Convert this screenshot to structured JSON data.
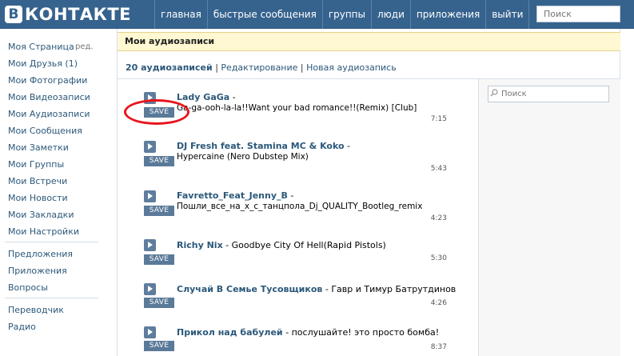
{
  "header": {
    "logo_letter": "В",
    "logo_text": "КОНТАКТЕ",
    "nav": [
      "главная",
      "быстрые сообщения",
      "группы",
      "люди",
      "приложения",
      "выйти"
    ],
    "search_placeholder": "Поиск"
  },
  "sidebar": {
    "items": [
      {
        "label": "Моя Страница",
        "edit": "ред."
      },
      {
        "label": "Мои Друзья (1)"
      },
      {
        "label": "Мои Фотографии"
      },
      {
        "label": "Мои Видеозаписи"
      },
      {
        "label": "Мои Аудиозаписи"
      },
      {
        "label": "Мои Сообщения"
      },
      {
        "label": "Мои Заметки"
      },
      {
        "label": "Мои Группы"
      },
      {
        "label": "Мои Встречи"
      },
      {
        "label": "Мои Новости"
      },
      {
        "label": "Мои Закладки"
      },
      {
        "label": "Мои Настройки"
      }
    ],
    "extra1": [
      "Предложения",
      "Приложения",
      "Вопросы"
    ],
    "extra2": [
      "Переводчик",
      "Радио"
    ]
  },
  "main": {
    "title": "Мои аудиозаписи",
    "count": "20 аудиозаписей",
    "links": [
      "Редактирование",
      "Новая аудиозапись"
    ],
    "sep": "|",
    "search_placeholder": "Поиск",
    "save_label": "SAVE",
    "tracks": [
      {
        "artist": "Lady GaGa",
        "dash": " -",
        "title": "",
        "line2": "Ga-ga-ooh-la-la!!Want your bad romance!!(Remix) [Club]",
        "duration": "7:15"
      },
      {
        "artist": "DJ Fresh feat. Stamina MC & Koko",
        "dash": " -",
        "title": "",
        "line2": "Hypercaine (Nero Dubstep Mix)",
        "duration": "5:43"
      },
      {
        "artist": "Favretto_Feat_Jenny_B",
        "dash": " -",
        "title": "",
        "line2": "Пошли_все_на_х_с_танцпола_Dj_QUALITY_Bootleg_remix",
        "duration": "4:23"
      },
      {
        "artist": "Richy Nix",
        "dash": " - ",
        "title": "Goodbye City Of Hell(Rapid Pistols)",
        "line2": "",
        "duration": "5:30"
      },
      {
        "artist": "Случай В Семье Тусовщиков",
        "dash": " - ",
        "title": "Гавр и Тимур Батрутдинов",
        "line2": "",
        "duration": "4:26"
      },
      {
        "artist": "Прикол над бабулей",
        "dash": " - ",
        "title": "послушайте! это просто бомба!",
        "line2": "",
        "duration": "8:37"
      }
    ]
  }
}
